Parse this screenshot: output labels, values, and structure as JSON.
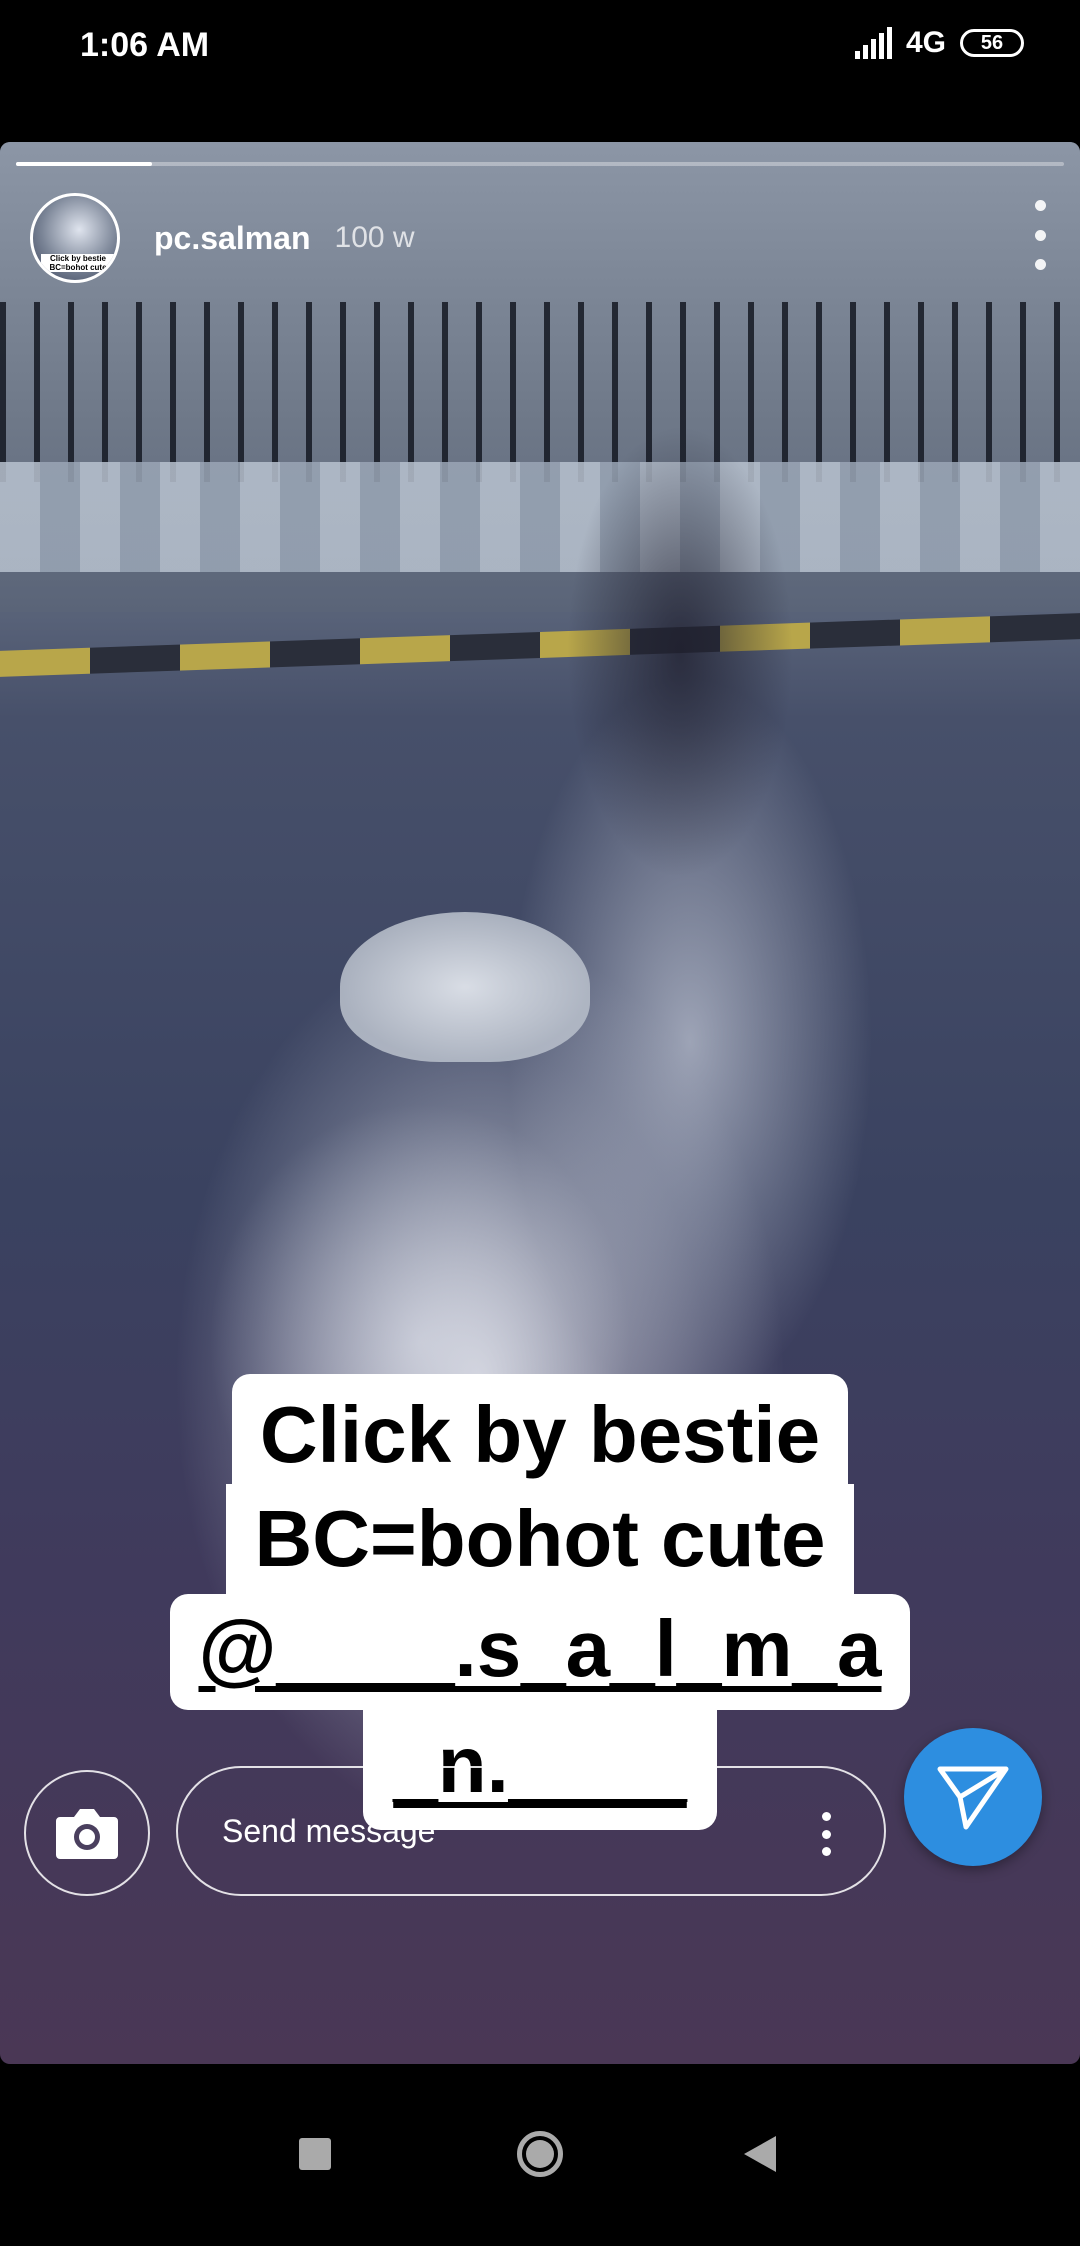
{
  "status_bar": {
    "time": "1:06 AM",
    "network": "4G",
    "battery": "56"
  },
  "story": {
    "progress": 0.13,
    "username": "pc.salman",
    "time_ago": "100 w",
    "avatar_caption": "Click by bestie BC=bohot cute",
    "caption_lines": [
      "Click by bestie",
      "BC=bohot cute",
      "@____.s_a_l_m_a",
      "_n.____"
    ]
  },
  "message_bar": {
    "placeholder": "Send message"
  },
  "icons": {
    "camera": "camera-icon",
    "send": "send-icon",
    "more": "more-vertical-icon",
    "nav_recents": "square-icon",
    "nav_home": "circle-icon",
    "nav_back": "triangle-back-icon"
  },
  "colors": {
    "send_button": "#2d8ee0",
    "background": "#000000"
  }
}
